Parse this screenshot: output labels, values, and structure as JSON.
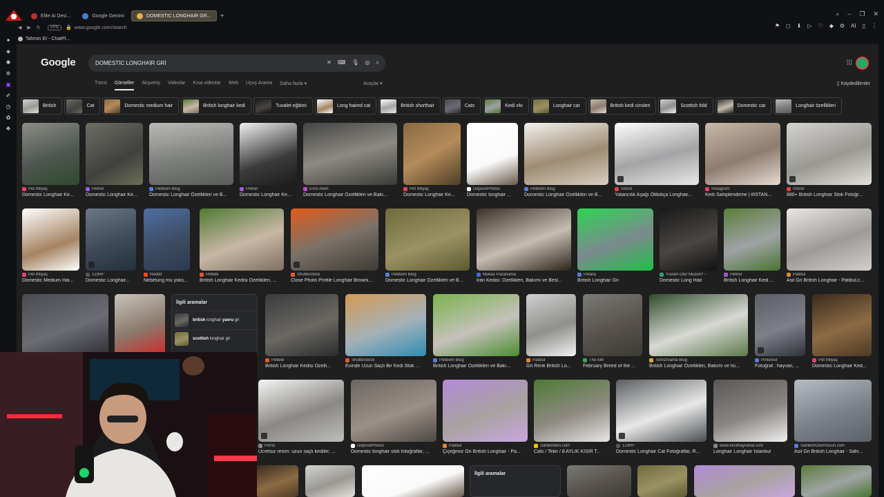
{
  "browser": {
    "tabs": [
      {
        "label": "Elite Ai Desi..."
      },
      {
        "label": "Google Gemini"
      },
      {
        "label": "DOMESTIC LONGHAIR GR...",
        "active": true
      }
    ],
    "new_tab": "+",
    "address": "www.google.com/search",
    "address_badge": "VPN",
    "bookmarks": [
      {
        "label": "Tahmin Et - ChatPl..."
      }
    ],
    "ai_label": "AI"
  },
  "google": {
    "logo": "Google",
    "query": "DOMESTİC LONGHAİR GRİ",
    "search_tabs": [
      {
        "label": "Tümü"
      },
      {
        "label": "Görseller",
        "active": true
      },
      {
        "label": "Alışveriş"
      },
      {
        "label": "Videolar"
      },
      {
        "label": "Kısa videolar"
      },
      {
        "label": "Web"
      },
      {
        "label": "Uçuş Arama"
      },
      {
        "label": "Daha fazla ▾"
      }
    ],
    "tools": "Araçlar ▾",
    "saved": "Kaydedilenler",
    "chips": [
      {
        "label": "British"
      },
      {
        "label": "Cat"
      },
      {
        "label": "Domestic medium hair"
      },
      {
        "label": "British longhair kedi"
      },
      {
        "label": "Tuvalet eğitimi"
      },
      {
        "label": "Long haired cat"
      },
      {
        "label": "British shorthair"
      },
      {
        "label": "Cats"
      },
      {
        "label": "Kedi ırkı"
      },
      {
        "label": "Longhair cat"
      },
      {
        "label": "British kedi cinsleri"
      },
      {
        "label": "Scottish fold"
      },
      {
        "label": "Domestic cat"
      },
      {
        "label": "Longhair özellikleri"
      }
    ],
    "rows": [
      [
        {
          "source": "Pet İhtiyaç",
          "title": "Domestic Longhair Ke...",
          "color": "#e0446a"
        },
        {
          "source": "Petner",
          "title": "Domestic Longhair Ke...",
          "color": "#9a5bd6"
        },
        {
          "source": "Petibom Blog",
          "title": "Domestic Longhair Özellikleri ve B...",
          "color": "#5b7bd6"
        },
        {
          "source": "Petner",
          "title": "Domestic Longhair Ke...",
          "color": "#9a5bd6"
        },
        {
          "source": "Evcil Alem",
          "title": "Domestic Longhair Özellikleri ve Bakı...",
          "color": "#c04ad0"
        },
        {
          "source": "Pet İhtiyaç",
          "title": "Domestic Longhair Ke...",
          "color": "#e0446a"
        },
        {
          "source": "DepositPhotos",
          "title": "Domestic longhair ...",
          "color": "#ffffff"
        },
        {
          "source": "Petibom Blog",
          "title": "Domestic Longhair Özellikleri ve B...",
          "color": "#5b7bd6"
        },
        {
          "source": "iStock",
          "title": "Yatancılık Aşağı Oldukça Longhair...",
          "color": "#d94646"
        },
        {
          "source": "Instagram",
          "title": "Kedi Sahiplendirme | #İSTAN...",
          "color": "#e0446a"
        },
        {
          "source": "iStock",
          "title": "880+ British Longhair Stok Fotoğr...",
          "color": "#d94646"
        }
      ],
      [
        {
          "source": "Pet İhtiyaç",
          "title": "Domestic Medium Hai...",
          "color": "#e0446a"
        },
        {
          "source": "123RF",
          "title": "Domestic Longhair...",
          "color": "#555555"
        },
        {
          "source": "Reddit",
          "title": "Nebelung mu yoks...",
          "color": "#ff4500"
        },
        {
          "source": "Petlebi",
          "title": "British Longhair Kedisi Özellikleri, ...",
          "color": "#e35b2a"
        },
        {
          "source": "Shutterstock",
          "title": "Close Photo Profile Longhair Browni...",
          "color": "#e35b2a"
        },
        {
          "source": "Petibom Blog",
          "title": "Domestic Longhair Özellikleri ve B...",
          "color": "#5b7bd6"
        },
        {
          "source": "Mukas Pazarlama",
          "title": "İran Kedisi: Özellikleri, Bakımı ve Besl...",
          "color": "#3a6fd8"
        },
        {
          "source": "Petara",
          "title": "British Longhair Gri",
          "color": "#5b7bd6"
        },
        {
          "source": "Yuvam Olur Musun? -",
          "title": "Domestic Long Hair",
          "color": "#29a36a"
        },
        {
          "source": "Petner",
          "title": "British Longhair Kedi ...",
          "color": "#9a5bd6"
        },
        {
          "source": "Patibul",
          "title": "Asil Gri British Longhair - Patibul.c...",
          "color": "#e08a2e"
        }
      ],
      [
        {
          "source": "Petlebi",
          "title": "British Longhair Kedisi Özelli...",
          "color": "#e35b2a"
        },
        {
          "source": "Shutterstock",
          "title": "Evinde Uzun Saçlı Bir Kedi Stok ...",
          "color": "#e35b2a"
        },
        {
          "source": "Petibom Blog",
          "title": "British Longhair Özellikleri ve Bakı...",
          "color": "#5b7bd6"
        },
        {
          "source": "Patibul",
          "title": "Gri Renk British Lo...",
          "color": "#e08a2e"
        },
        {
          "source": "The Mill",
          "title": "February Breed of the ...",
          "color": "#3aa55c"
        },
        {
          "source": "Temizmama Blog",
          "title": "British Longhair Özellikleri, Bakımı ve İsi...",
          "color": "#e0a82e"
        },
        {
          "source": "Pinterest",
          "title": "Fotoğraf : hayvan, ...",
          "color": "#5b7bd6"
        },
        {
          "source": "Pet İhtiyaç",
          "title": "Domestic Longhair Ked...",
          "color": "#e0446a"
        }
      ],
      [
        {
          "source": "Pxmo",
          "title": "Ücretsiz resim: uzun saçlı kediler, ...",
          "color": "#888888"
        },
        {
          "source": "DepositPhotos",
          "title": "Domestic longhair stok fotoğraflar, ...",
          "color": "#ffffff"
        },
        {
          "source": "Patibul",
          "title": "Çiçeğimiz Gri British Longhair - Pa...",
          "color": "#e08a2e"
        },
        {
          "source": "Sahibinden.com",
          "title": "Cats / Tekir / 8 AYLIK KISIR T...",
          "color": "#f1c40f"
        },
        {
          "source": "123RF",
          "title": "Domestic Longhair Cat Fotoğraflar, R...",
          "color": "#555555"
        },
        {
          "source": "www.evcilhayvanal.com",
          "title": "Longhair Longhair İstanbul",
          "color": "#888888"
        },
        {
          "source": "SahibimOlurmusun.com",
          "title": "Asil Gri British Longhair - Sahi...",
          "color": "#5b7bd6"
        }
      ]
    ],
    "related": {
      "heading": "İlgili aramalar",
      "items": [
        {
          "bold": "british",
          "rest": " longhair ",
          "bold2": "yavru",
          "rest2": " gri"
        },
        {
          "bold": "scottish",
          "rest": " longhair gri",
          "bold2": "",
          "rest2": ""
        }
      ]
    },
    "related2_heading": "İlgili aramalar"
  }
}
